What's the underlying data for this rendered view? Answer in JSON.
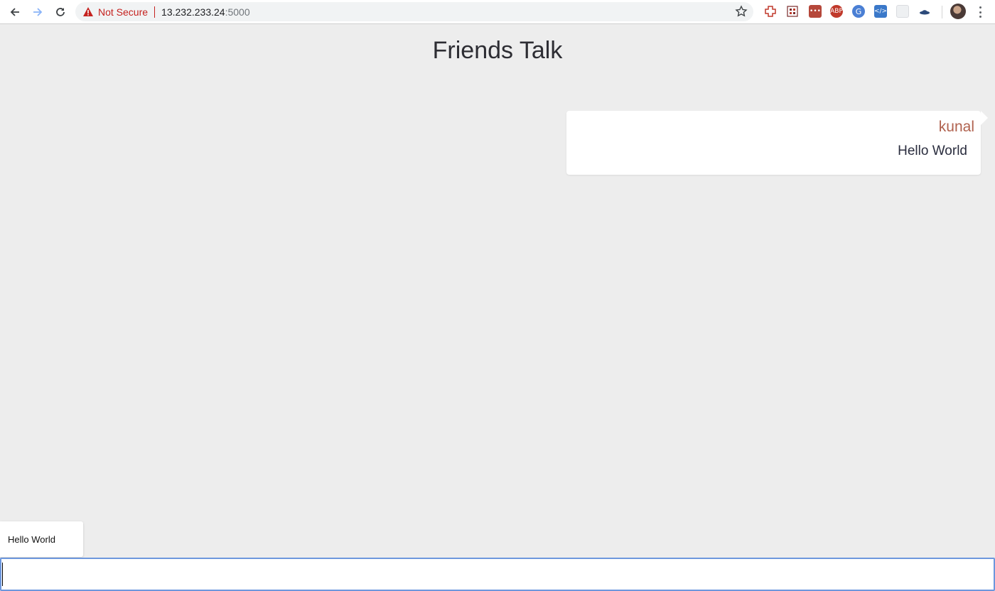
{
  "browser": {
    "security_label": "Not Secure",
    "url_host": "13.232.233.24",
    "url_port": ":5000"
  },
  "page": {
    "title": "Friends Talk"
  },
  "messages": [
    {
      "user": "kunal",
      "text": "Hello World"
    }
  ],
  "autocomplete": {
    "suggestion": "Hello World"
  },
  "input": {
    "value": "",
    "placeholder": ""
  },
  "colors": {
    "background": "#ededed",
    "username": "#b0624f",
    "message_text": "#2a2d3e",
    "input_focus_border": "#6d97dd",
    "not_secure": "#c5221f"
  },
  "icons": {
    "back": "back-arrow-icon",
    "forward": "forward-arrow-icon",
    "reload": "reload-icon",
    "warning": "warning-triangle-icon",
    "bookmark": "star-icon",
    "menu": "kebab-menu-icon"
  }
}
